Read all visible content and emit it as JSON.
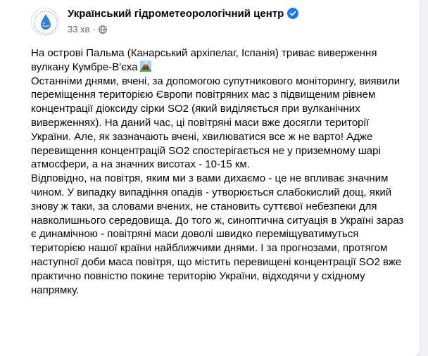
{
  "post": {
    "page_name": "Український гідрометеорологічний центр",
    "timestamp": "33 хв",
    "separator": "·",
    "paragraphs": [
      "На острові Пальма (Канарський архіпелаг, Іспанія) триває виверження вулкану Кумбре-В'єха",
      "Останніми днями, вчені, за допомогою супутникового моніторингу, виявили переміщення територією Європи повітряних мас з підвищеним рівнем концентрації діоксиду сірки SO2 (який виділяється при вулканічних виверженнях). На даний час, ці повітряні маси вже досягли території України. Але, як зазначають вчені, хвилюватися все ж не варто! Адже перевищення концентрацій SO2 спостерігається не у приземному шарі атмосфери, а на значних висотах - 10-15 км.",
      "Відповідно, на повітря, яким ми з вами дихаємо - це не впливає значним чином. У випадку випадіння опадів - утворюється слабокислий дощ, який знову ж таки, за словами вчених, не становить суттєвої небезпеки для навколишнього середовища. До того ж, синоптична ситуація в Україні зараз є динамічною - повітряні маси доволі швидко переміщуватимуться територією нашої країни найближчими днями. І за прогнозами, протягом наступної доби маса повітря, що містить перевищені концентрації SO2 вже практично повністю покине територію України, відходячи у східному напрямку."
    ]
  },
  "icons": {
    "avatar": "water-drop-logo-icon",
    "verified": "verified-badge-icon",
    "audience": "globe-icon",
    "emoji": "volcano-emoji-icon"
  },
  "colors": {
    "verified": "#1877f2",
    "logo": "#2f80d9"
  }
}
